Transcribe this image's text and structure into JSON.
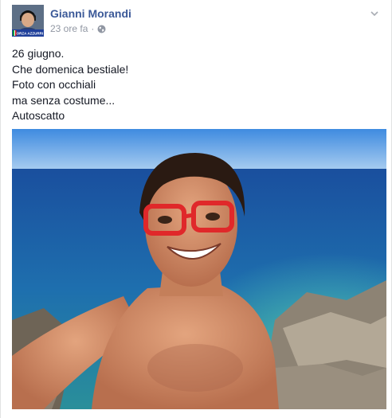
{
  "post": {
    "author": "Gianni Morandi",
    "time": "23 ore fa",
    "separator": "·",
    "avatar_badge": "FORZA AZZURRI",
    "lines": [
      "26 giugno.",
      "Che domenica bestiale!",
      "Foto con occhiali",
      "ma senza costume...",
      "Autoscatto"
    ]
  },
  "icons": {
    "privacy": "globe-icon",
    "menu": "chevron-down-icon"
  },
  "colors": {
    "link": "#3b5998",
    "meta": "#9197a3",
    "text": "#141823"
  }
}
